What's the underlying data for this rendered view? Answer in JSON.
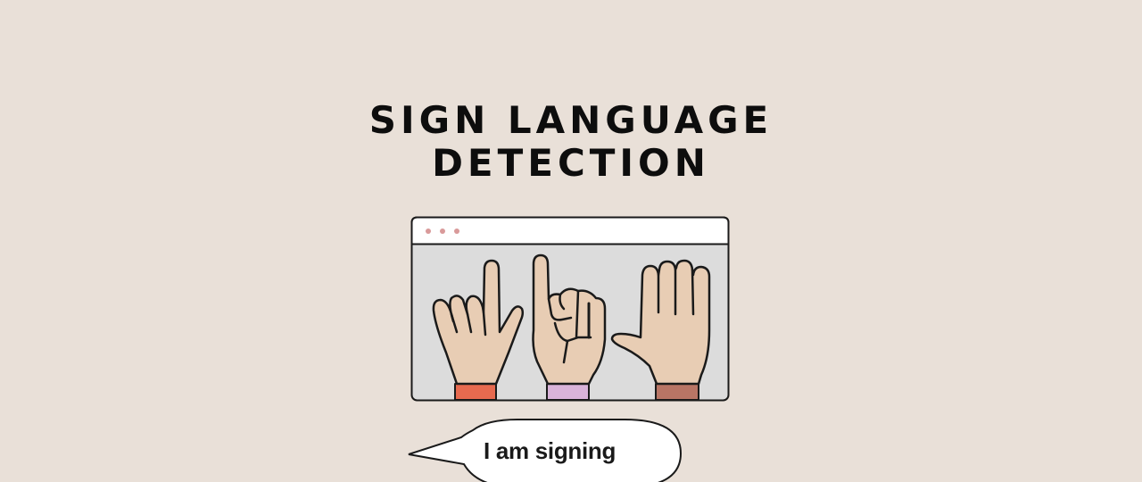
{
  "title": {
    "line1": "SIGN LANGUAGE",
    "line2": "DETECTION"
  },
  "window": {
    "dots": [
      "dot",
      "dot",
      "dot"
    ]
  },
  "hands": [
    {
      "name": "hand-sign-1",
      "cuff_color": "#e76a4f"
    },
    {
      "name": "hand-sign-2",
      "cuff_color": "#d9b3d9"
    },
    {
      "name": "hand-sign-3",
      "cuff_color": "#b87565"
    }
  ],
  "speech_bubble": {
    "text": "I am signing"
  },
  "colors": {
    "background": "#e9e0d8",
    "skin": "#e8cdb4",
    "window_fill": "#dcdcdc",
    "outline": "#1a1a1a",
    "dot": "#d99a9a"
  }
}
